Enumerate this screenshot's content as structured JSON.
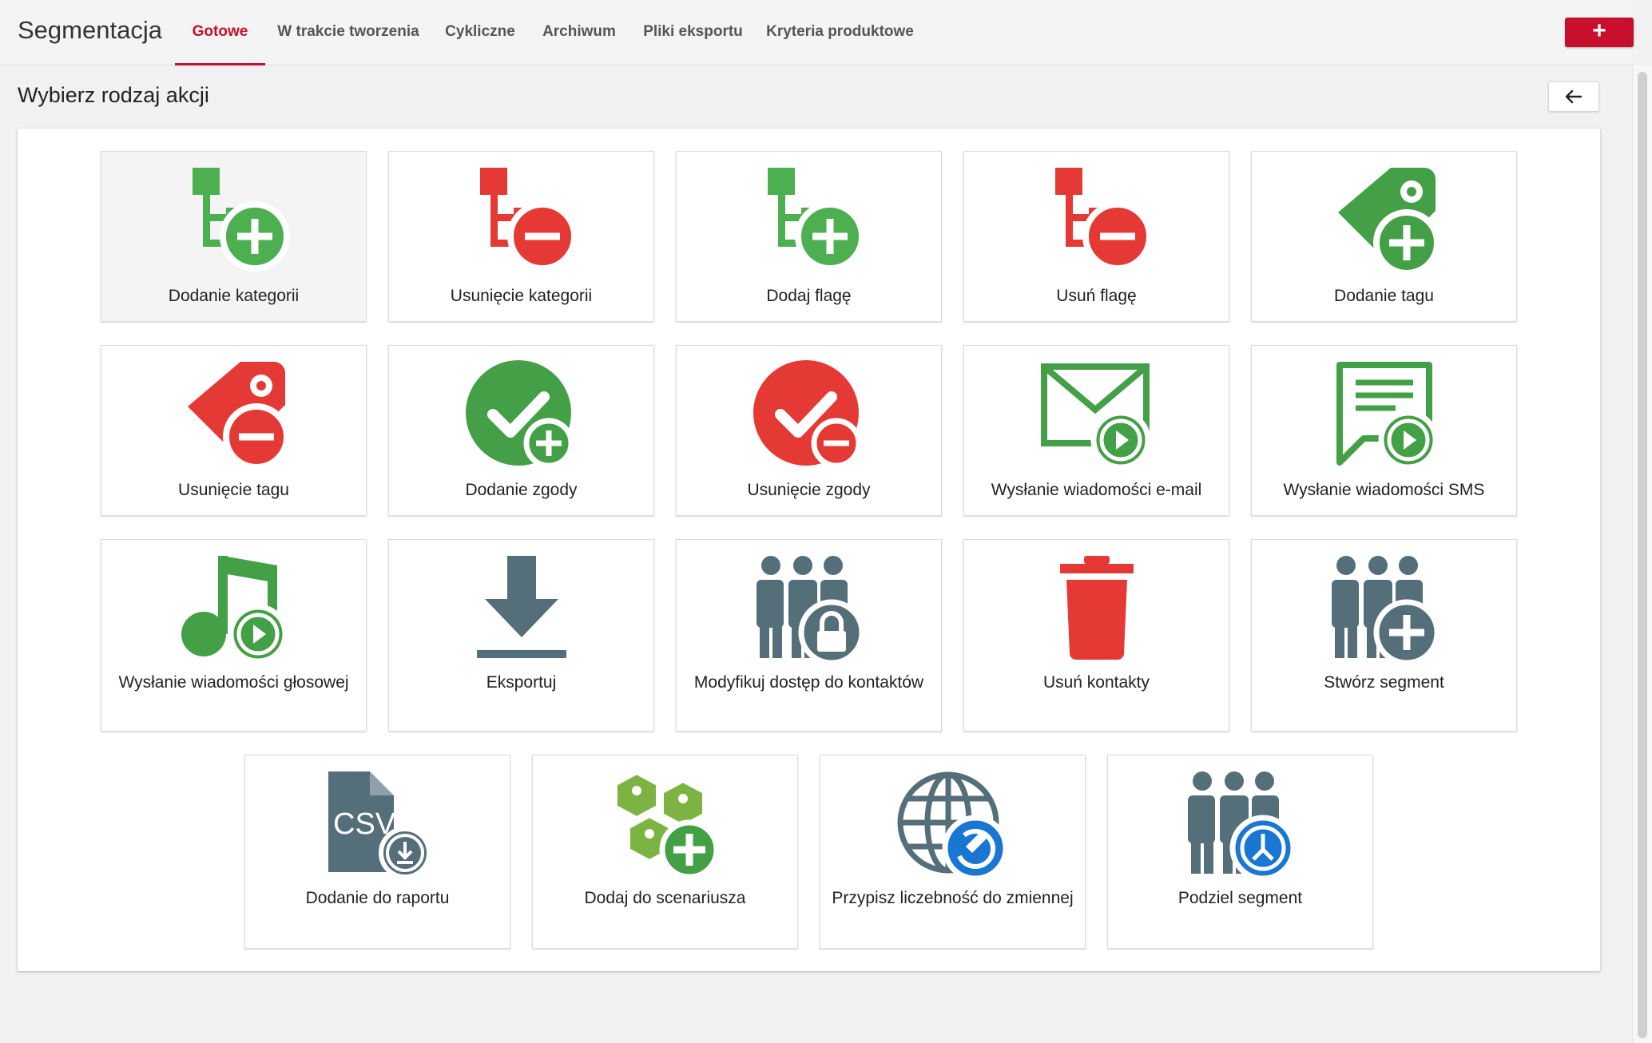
{
  "header": {
    "app_title": "Segmentacja",
    "tabs": [
      {
        "label": "Gotowe",
        "active": true
      },
      {
        "label": "W trakcie tworzenia"
      },
      {
        "label": "Cykliczne"
      },
      {
        "label": "Archiwum"
      },
      {
        "label": "Pliki eksportu"
      },
      {
        "label": "Kryteria produktowe"
      }
    ],
    "add_button_label": "+"
  },
  "page": {
    "title": "Wybierz rodzaj akcji",
    "back_icon": "arrow-left-icon"
  },
  "actions": [
    {
      "label": "Dodanie kategorii",
      "icon": "category-add-icon",
      "color": "#4caf50"
    },
    {
      "label": "Usunięcie kategorii",
      "icon": "category-remove-icon",
      "color": "#e53935"
    },
    {
      "label": "Dodaj flagę",
      "icon": "flag-add-icon",
      "color": "#4caf50"
    },
    {
      "label": "Usuń flagę",
      "icon": "flag-remove-icon",
      "color": "#e53935"
    },
    {
      "label": "Dodanie tagu",
      "icon": "tag-add-icon",
      "color": "#43a047"
    },
    {
      "label": "Usunięcie tagu",
      "icon": "tag-remove-icon",
      "color": "#e53935"
    },
    {
      "label": "Dodanie zgody",
      "icon": "consent-add-icon",
      "color": "#43a047"
    },
    {
      "label": "Usunięcie zgody",
      "icon": "consent-remove-icon",
      "color": "#e53935"
    },
    {
      "label": "Wysłanie wiadomości e-mail",
      "icon": "email-send-icon",
      "color": "#43a047"
    },
    {
      "label": "Wysłanie wiadomości SMS",
      "icon": "sms-send-icon",
      "color": "#43a047"
    },
    {
      "label": "Wysłanie wiadomości głosowej",
      "icon": "voice-send-icon",
      "color": "#43a047"
    },
    {
      "label": "Eksportuj",
      "icon": "download-icon",
      "color": "#546e7a"
    },
    {
      "label": "Modyfikuj dostęp do kontaktów",
      "icon": "group-lock-icon",
      "color": "#546e7a"
    },
    {
      "label": "Usuń kontakty",
      "icon": "trash-icon",
      "color": "#e53935"
    },
    {
      "label": "Stwórz segment",
      "icon": "group-add-icon",
      "color": "#546e7a"
    },
    {
      "label": "Dodanie do raportu",
      "icon": "csv-download-icon",
      "color": "#546e7a"
    },
    {
      "label": "Dodaj do scenariusza",
      "icon": "scenario-add-icon",
      "color": "#7cb342"
    },
    {
      "label": "Przypisz liczebność do zmiennej",
      "icon": "globe-edit-icon",
      "color": "#546e7a"
    },
    {
      "label": "Podziel segment",
      "icon": "group-split-icon",
      "color": "#1976d2"
    }
  ],
  "icon_text": {
    "csv": "CSV"
  },
  "colors": {
    "accent": "#c8102e",
    "green": "#43a047",
    "red": "#e53935",
    "slate": "#546e7a",
    "blue": "#1976d2"
  }
}
